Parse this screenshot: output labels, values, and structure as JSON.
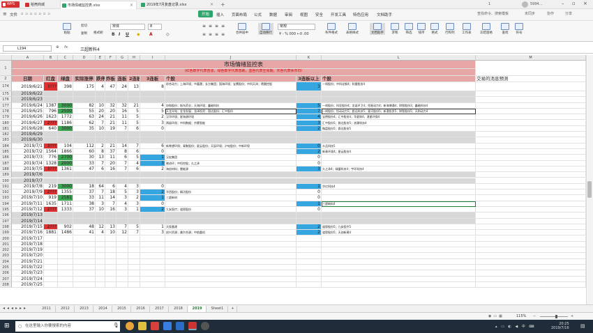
{
  "titlebar": {
    "app": "WPS",
    "tabs": [
      {
        "label": "稻壳商城",
        "color": "#d62f2f"
      },
      {
        "label": "市场情绪监控表.xlsx",
        "color": "#30a46c"
      },
      {
        "label": "2019年7月复盘记录.xlsx",
        "color": "#30a46c"
      }
    ],
    "counter": "1",
    "user": "5994..."
  },
  "menu": {
    "file": "文件",
    "items": [
      "开始",
      "插入",
      "页面布局",
      "公式",
      "数据",
      "审阅",
      "视图",
      "安全",
      "开发工具",
      "特色应用",
      "文档助手"
    ],
    "search": "查找命令、搜索模板",
    "right": [
      "未同步",
      "协作",
      "分享"
    ]
  },
  "ribbon": {
    "paste": "粘贴",
    "cut": "剪切",
    "copy": "复制",
    "format_painter": "格式刷",
    "font_name": "宋体",
    "font_size": "8",
    "merge": "合并居中",
    "wrap": "自动换行",
    "numfmt": "常规",
    "right": [
      "条件格式",
      "表格样式",
      "文档助手",
      "求和",
      "筛选",
      "排序",
      "格式",
      "行和列",
      "工作表",
      "冻结窗格",
      "查找",
      "符号"
    ]
  },
  "formula": {
    "cell": "L194",
    "fx": "fx",
    "content": "三超新料4"
  },
  "columns": [
    "A",
    "B",
    "C",
    "D",
    "E",
    "F",
    "G",
    "H",
    "I",
    "J",
    "K",
    "L",
    "M"
  ],
  "header": {
    "title": "市场情绪监控表",
    "subtitle": "（红色数字代表普涨，绿色数字代表普跌，蓝色代表空周期，灰色代表休市日）",
    "cols": [
      "日期",
      "红盘",
      "绿盘",
      "实际涨停",
      "跌停",
      "炸板",
      "连板",
      "2连板",
      "3连板",
      "个股",
      "3连板以上",
      "个股",
      "交易的消息预测"
    ]
  },
  "rows": [
    {
      "r": "174",
      "date": "2019/6/21",
      "red": "3???",
      "green": "398",
      "zt": "175",
      "dt": "4",
      "zb": "47",
      "lb": "24",
      "b2": "13",
      "b3": "8",
      "stock": "综合动力；上海环境；中嘉晟；长方集团；国海环境；宝鹰股份；中科天泽；德晨控股",
      "k": "3",
      "L": "一线股份；中科化钢4；科雷股份4",
      "rc": "red",
      "kc": "blue",
      "tall": true
    },
    {
      "r": "175",
      "date": "2019/6/22",
      "gray": true
    },
    {
      "r": "176",
      "date": "2019/6/23",
      "gray": true
    },
    {
      "r": "177",
      "date": "2019/6/24",
      "red": "1387",
      "green": "3000",
      "zt": "82",
      "dt": "10",
      "zb": "32",
      "lb": "32",
      "b2": "21",
      "b3": "4",
      "stock": "协和股份；振东药业；天海环境；鑫磁科技",
      "k": "5",
      "L": "一线股份；科亚股份4；龙涎环卫4；恒星动力4；新海博通4；财智股份3；鑫磁科技4",
      "gc": "green",
      "kc": "blue"
    },
    {
      "r": "178",
      "date": "2019/6/25",
      "red": "796",
      "green": "2500",
      "zt": "55",
      "dt": "20",
      "zb": "20",
      "lb": "16",
      "b2": "5",
      "b3": "5",
      "stock": "天龙光电；金龙发展；龙泽投资；固达股份；汇中股份",
      "k": "7",
      "L": "一线股份；恒动动力5；超远科技5；星河股份5；新潜投资5；财智股份5；天和动力4",
      "gc": "green",
      "kc": "blue",
      "boxed": true
    },
    {
      "r": "179",
      "date": "2019/6/26",
      "red": "1623",
      "green": "1772",
      "zt": "63",
      "dt": "24",
      "zb": "21",
      "lb": "11",
      "b2": "5",
      "b3": "2",
      "stock": "汉华环境；星海源环境",
      "k": "4",
      "L": "宝德股份4；汇中股份4；华夏财4；湛星环保4",
      "kc": "blue"
    },
    {
      "r": "180",
      "date": "2019/6/27",
      "red": "2???",
      "green": "1186",
      "zt": "62",
      "dt": "7",
      "zb": "21",
      "lb": "11",
      "b2": "5",
      "b3": "3",
      "stock": "两极环保；中科数据；京蒙智能",
      "k": "3",
      "L": "汇中股份5；群达股份5；浪潮科技4",
      "rc": "red",
      "kc": "blue"
    },
    {
      "r": "181",
      "date": "2019/6/28",
      "red": "640",
      "green": "3000",
      "zt": "35",
      "dt": "10",
      "zb": "19",
      "lb": "7",
      "b2": "6",
      "b3": "0",
      "stock": "",
      "k": "2",
      "L": "微盘股份5；群达股份5",
      "gc": "green",
      "kc": "blue"
    },
    {
      "r": "182",
      "date": "2019/6/29",
      "gray": true
    },
    {
      "r": "183",
      "date": "2019/6/30",
      "gray": true
    },
    {
      "r": "184",
      "date": "2019/7/1",
      "red": "3???",
      "green": "104",
      "zt": "112",
      "dt": "2",
      "zb": "21",
      "lb": "14",
      "b2": "7",
      "b3": "6",
      "stock": "新希望环保；青聚股份；星云股份；天辰环境；沪电股份；中新环保",
      "k": "0",
      "L": "众品科技5",
      "rc": "red",
      "kc": "blue"
    },
    {
      "r": "185",
      "date": "2019/7/2",
      "red": "1564",
      "green": "1866",
      "zt": "60",
      "dt": "8",
      "zb": "37",
      "lb": "8",
      "b2": "6",
      "b3": "0",
      "stock": "",
      "k": "2",
      "L": "新青环境4；星云股份4",
      "kc": "blue"
    },
    {
      "r": "186",
      "date": "2019/7/3",
      "red": "776",
      "green": "2700",
      "zt": "30",
      "dt": "13",
      "lb": "6",
      "zb": "11",
      "b2": "5",
      "b3": "1",
      "stock": "汉宏集团",
      "k": "0",
      "gc": "green",
      "b3c": "blue"
    },
    {
      "r": "187",
      "date": "2019/7/4",
      "red": "1328",
      "green": "2000",
      "zt": "33",
      "dt": "7",
      "zb": "20",
      "lb": "7",
      "b2": "4",
      "b3": "3",
      "stock": "晓进环；中恒控股；久之泽",
      "k": "0",
      "gc": "green",
      "b3c": "blue"
    },
    {
      "r": "188",
      "date": "2019/7/5",
      "red": "3???",
      "green": "1361",
      "zt": "47",
      "dt": "6",
      "zb": "16",
      "lb": "7",
      "b2": "6",
      "b3": "2",
      "stock": "海创材料；雷能源",
      "k": "3",
      "L": "久之泽4；绿盟科技4；宇环科技4",
      "rc": "red",
      "kc": "blue"
    },
    {
      "r": "189",
      "date": "2019/7/6",
      "gray": true
    },
    {
      "r": "190",
      "date": "2019/7/7",
      "gray": true
    },
    {
      "r": "191",
      "date": "2019/7/8",
      "red": "219",
      "green": "3000",
      "zt": "18",
      "dt": "64",
      "zb": "6",
      "lb": "4",
      "b2": "3",
      "b3": "0",
      "stock": "",
      "k": "1",
      "L": "华亿科技4",
      "gc": "green",
      "kc": "blue"
    },
    {
      "r": "192",
      "date": "2019/7/9",
      "red": "2???",
      "green": "1355",
      "zt": "37",
      "dt": "7",
      "zb": "18",
      "lb": "5",
      "b2": "3",
      "b3": "2",
      "stock": "华西股份；精功股份",
      "k": "0",
      "rc": "red",
      "b3c": "blue"
    },
    {
      "r": "193",
      "date": "2019/7/10",
      "red": "919",
      "green": "2581",
      "zt": "33",
      "dt": "11",
      "zb": "14",
      "lb": "3",
      "b2": "2",
      "b3": "1",
      "stock": "三超新材",
      "k": "0",
      "gc": "green",
      "b3c": "blue"
    },
    {
      "r": "194",
      "date": "2019/7/11",
      "red": "1635",
      "green": "1711",
      "zt": "38",
      "dt": "3",
      "zb": "7",
      "lb": "4",
      "b2": "3",
      "b3": "0",
      "stock": "",
      "k": "1",
      "L": "三超新料4",
      "kc": "blue",
      "sel": true
    },
    {
      "r": "195",
      "date": "2019/7/12",
      "red": "2???",
      "green": "1333",
      "zt": "37",
      "dt": "10",
      "zb": "16",
      "lb": "3",
      "b2": "1",
      "b3": "2",
      "stock": "九安医疗；道恩股份",
      "k": "0",
      "rc": "red",
      "b3c": "blue"
    },
    {
      "r": "196",
      "date": "2019/7/13",
      "gray": true
    },
    {
      "r": "197",
      "date": "2019/7/14",
      "gray": true
    },
    {
      "r": "198",
      "date": "2019/7/15",
      "red": "2???",
      "green": "902",
      "zt": "48",
      "dt": "12",
      "zb": "13",
      "lb": "7",
      "b2": "5",
      "b3": "1",
      "stock": "天保基建",
      "k": "2",
      "L": "道恩股份5；九安医疗5",
      "rc": "red",
      "kc": "blue"
    },
    {
      "r": "199",
      "date": "2019/7/16",
      "red": "1881",
      "green": "1486",
      "zt": "41",
      "dt": "4",
      "zb": "10",
      "lb": "12",
      "b2": "7",
      "b3": "3",
      "stock": "创兴资源；美尔合源；中航重机",
      "k": "2",
      "L": "道恩股份5；天创新建4",
      "kc": "blue"
    },
    {
      "r": "200",
      "date": "2019/7/17"
    },
    {
      "r": "201",
      "date": "2019/7/18"
    },
    {
      "r": "202",
      "date": "2019/7/19"
    },
    {
      "r": "203",
      "date": "2019/7/20"
    },
    {
      "r": "204",
      "date": "2019/7/21"
    },
    {
      "r": "205",
      "date": "2019/7/22"
    },
    {
      "r": "206",
      "date": "2019/7/23"
    },
    {
      "r": "207",
      "date": "2019/7/24"
    },
    {
      "r": "208",
      "date": "2019/7/25"
    }
  ],
  "sheets": [
    "2011",
    "2012",
    "2013",
    "2014",
    "2015",
    "2016",
    "2017",
    "2018",
    "2019",
    "Sheet1",
    "+"
  ],
  "status": {
    "zoom": "115%"
  },
  "taskbar": {
    "search": "在这里输入你要搜索的内容",
    "time": "20:25",
    "date": "2019/7/16"
  },
  "colors": {
    "red": "#e03030",
    "green": "#3aa850",
    "blue": "#35a6e0",
    "gray": "#d8d8d8",
    "header": "#e6a6a6"
  }
}
